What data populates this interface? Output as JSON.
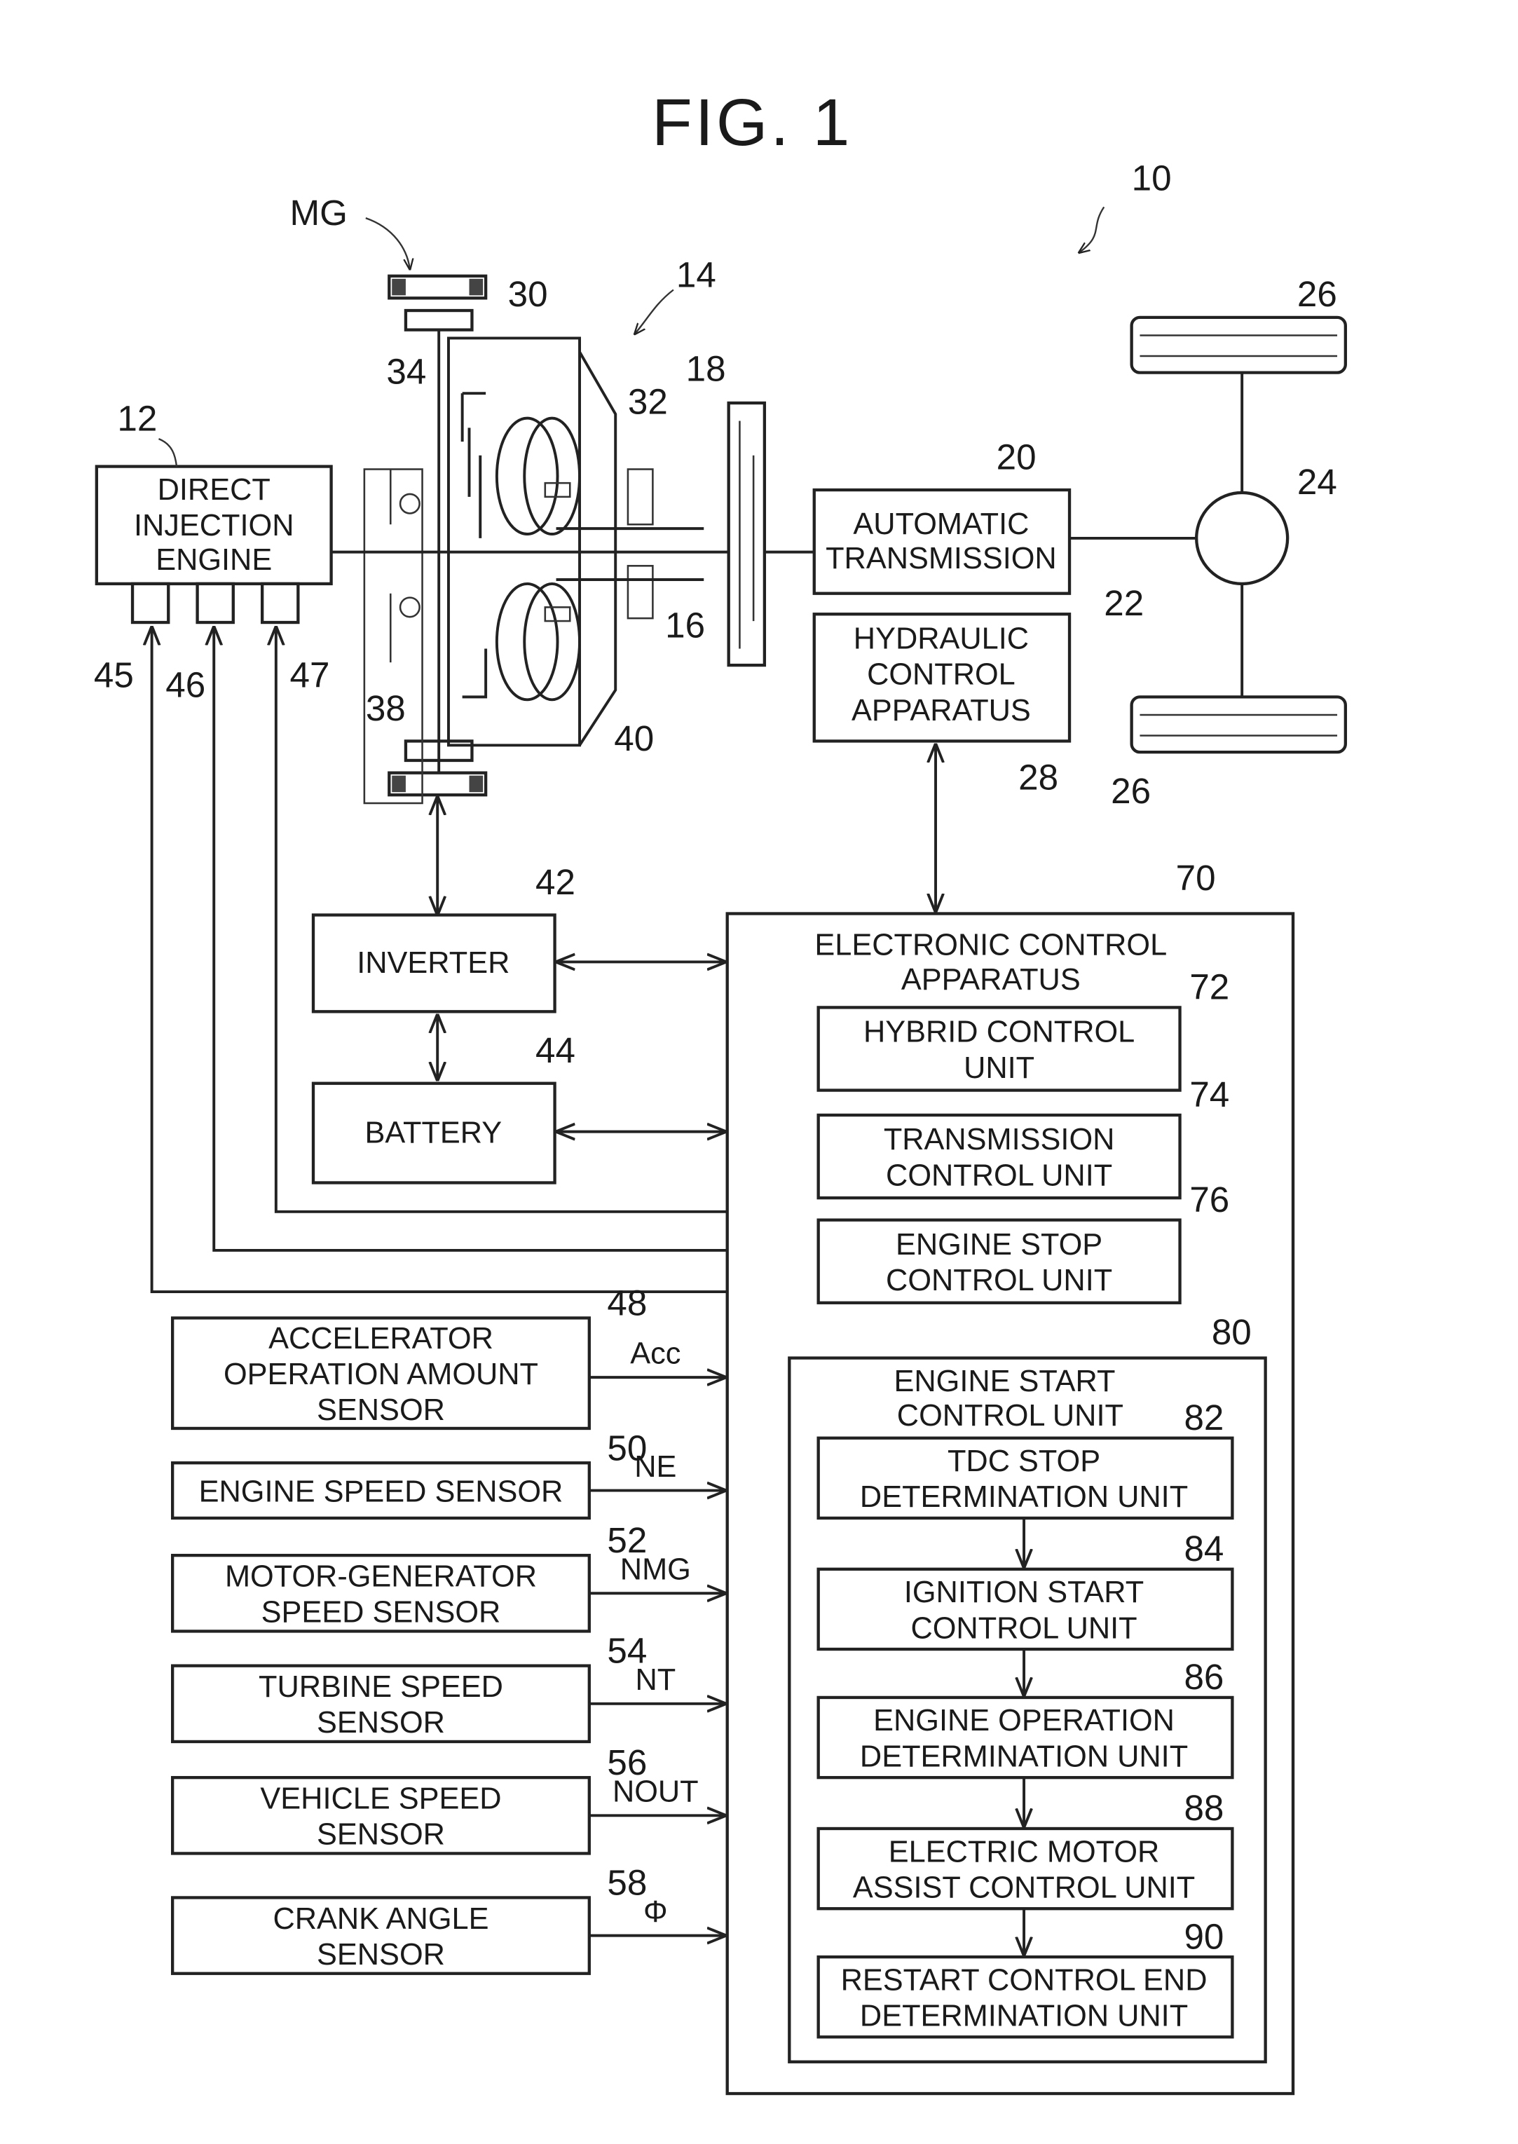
{
  "figure": {
    "title": "FIG. 1",
    "system_ref": "10",
    "motor_generator_label": "MG",
    "converter_ref": "14"
  },
  "components": {
    "engine": {
      "ref": "12",
      "lines": [
        "DIRECT",
        "INJECTION",
        "ENGINE"
      ],
      "ports": [
        "45",
        "46",
        "47"
      ]
    },
    "automatic_transmission": {
      "ref": "20",
      "lines": [
        "AUTOMATIC",
        "TRANSMISSION"
      ]
    },
    "hydraulic_control": {
      "ref": "28",
      "lines": [
        "HYDRAULIC",
        "CONTROL",
        "APPARATUS"
      ]
    },
    "inverter": {
      "ref": "42",
      "label": "INVERTER"
    },
    "battery": {
      "ref": "44",
      "label": "BATTERY"
    },
    "differential_ref": "24",
    "wheel_ref": "26",
    "output_shaft_ref": "22",
    "mechanical_refs": [
      "30",
      "34",
      "32",
      "18",
      "16",
      "38",
      "40"
    ]
  },
  "ecu": {
    "ref": "70",
    "lines": [
      "ELECTRONIC CONTROL",
      "APPARATUS"
    ],
    "units": [
      {
        "ref": "72",
        "lines": [
          "HYBRID CONTROL",
          "UNIT"
        ]
      },
      {
        "ref": "74",
        "lines": [
          "TRANSMISSION",
          "CONTROL UNIT"
        ]
      },
      {
        "ref": "76",
        "lines": [
          "ENGINE STOP",
          "CONTROL UNIT"
        ]
      }
    ],
    "engine_start": {
      "ref": "80",
      "lines": [
        "ENGINE START",
        "CONTROL UNIT"
      ],
      "steps": [
        {
          "ref": "82",
          "lines": [
            "TDC STOP",
            "DETERMINATION UNIT"
          ]
        },
        {
          "ref": "84",
          "lines": [
            "IGNITION START",
            "CONTROL UNIT"
          ]
        },
        {
          "ref": "86",
          "lines": [
            "ENGINE OPERATION",
            "DETERMINATION UNIT"
          ]
        },
        {
          "ref": "88",
          "lines": [
            "ELECTRIC MOTOR",
            "ASSIST CONTROL UNIT"
          ]
        },
        {
          "ref": "90",
          "lines": [
            "RESTART CONTROL END",
            "DETERMINATION UNIT"
          ]
        }
      ]
    }
  },
  "sensors": [
    {
      "ref": "48",
      "signal": "Acc",
      "lines": [
        "ACCELERATOR",
        "OPERATION AMOUNT",
        "SENSOR"
      ]
    },
    {
      "ref": "50",
      "signal": "NE",
      "lines": [
        "ENGINE SPEED SENSOR"
      ]
    },
    {
      "ref": "52",
      "signal": "NMG",
      "lines": [
        "MOTOR-GENERATOR",
        "SPEED SENSOR"
      ]
    },
    {
      "ref": "54",
      "signal": "NT",
      "lines": [
        "TURBINE SPEED",
        "SENSOR"
      ]
    },
    {
      "ref": "56",
      "signal": "NOUT",
      "lines": [
        "VEHICLE SPEED",
        "SENSOR"
      ]
    },
    {
      "ref": "58",
      "signal": "Φ",
      "lines": [
        "CRANK ANGLE",
        "SENSOR"
      ]
    }
  ]
}
